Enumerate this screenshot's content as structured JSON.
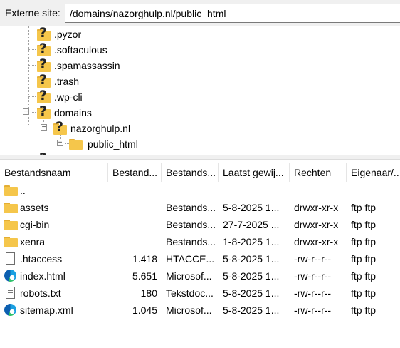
{
  "pathbar": {
    "label": "Externe site:",
    "value": "/domains/nazorghulp.nl/public_html"
  },
  "tree": {
    "items": [
      {
        "label": ".pyzor",
        "icon": "unknown-folder-icon"
      },
      {
        "label": ".softaculous",
        "icon": "unknown-folder-icon"
      },
      {
        "label": ".spamassassin",
        "icon": "unknown-folder-icon"
      },
      {
        "label": ".trash",
        "icon": "unknown-folder-icon"
      },
      {
        "label": ".wp-cli",
        "icon": "unknown-folder-icon"
      },
      {
        "label": "domains",
        "icon": "unknown-folder-icon",
        "expander": "−"
      },
      {
        "label": "nazorghulp.nl",
        "icon": "unknown-folder-icon",
        "expander": "−"
      },
      {
        "label": "public_html",
        "icon": "folder-icon",
        "expander": "+"
      }
    ]
  },
  "list": {
    "columns": [
      "Bestandsnaam",
      "Bestand...",
      "Bestands...",
      "Laatst gewij...",
      "Rechten",
      "Eigenaar/..."
    ],
    "rows": [
      {
        "name": "..",
        "size": "",
        "type": "",
        "modified": "",
        "perms": "",
        "owner": "",
        "icon": "folder-icon"
      },
      {
        "name": "assets",
        "size": "",
        "type": "Bestands...",
        "modified": "5-8-2025 1...",
        "perms": "drwxr-xr-x",
        "owner": "ftp ftp",
        "icon": "folder-icon"
      },
      {
        "name": "cgi-bin",
        "size": "",
        "type": "Bestands...",
        "modified": "27-7-2025 ...",
        "perms": "drwxr-xr-x",
        "owner": "ftp ftp",
        "icon": "folder-icon"
      },
      {
        "name": "xenra",
        "size": "",
        "type": "Bestands...",
        "modified": "1-8-2025 1...",
        "perms": "drwxr-xr-x",
        "owner": "ftp ftp",
        "icon": "folder-icon"
      },
      {
        "name": ".htaccess",
        "size": "1.418",
        "type": "HTACCE...",
        "modified": "5-8-2025 1...",
        "perms": "-rw-r--r--",
        "owner": "ftp ftp",
        "icon": "file-icon"
      },
      {
        "name": "index.html",
        "size": "5.651",
        "type": "Microsof...",
        "modified": "5-8-2025 1...",
        "perms": "-rw-r--r--",
        "owner": "ftp ftp",
        "icon": "edge-icon"
      },
      {
        "name": "robots.txt",
        "size": "180",
        "type": "Tekstdoc...",
        "modified": "5-8-2025 1...",
        "perms": "-rw-r--r--",
        "owner": "ftp ftp",
        "icon": "text-file-icon"
      },
      {
        "name": "sitemap.xml",
        "size": "1.045",
        "type": "Microsof...",
        "modified": "5-8-2025 1...",
        "perms": "-rw-r--r--",
        "owner": "ftp ftp",
        "icon": "edge-icon"
      }
    ]
  }
}
